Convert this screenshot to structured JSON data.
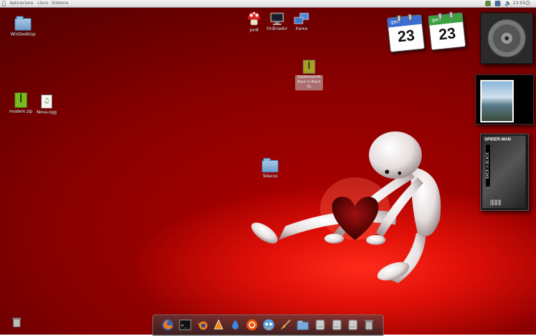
{
  "menubar": {
    "menus": [
      "Aplicacions",
      "Llocs",
      "Sistema"
    ],
    "clock": "23:05"
  },
  "desktop_icons": {
    "windesktop": "WinDesktop",
    "jordi": "jordi",
    "ordinador": "Ordinador",
    "xarxa": "Xarxa",
    "modem": "modem.zip",
    "nova": "Nova.ogg",
    "telecos": "Telecos",
    "selected_file": "Spiderman04 Back in Black 01"
  },
  "calendars": [
    {
      "month": "gen",
      "day": "23",
      "color": "#3a6fd0"
    },
    {
      "month": "gen",
      "day": "23",
      "color": "#3aa040"
    }
  ],
  "dock": {
    "items": [
      "firefox-icon",
      "terminal-icon",
      "blender-icon",
      "vlc-icon",
      "water-drop-icon",
      "ubuntu-icon",
      "pidgin-icon",
      "broom-icon",
      "folder-icon",
      "drive-icon",
      "drive-icon",
      "drive-icon",
      "trash-icon"
    ]
  },
  "widgets": {
    "comic_title": "SPIDER-MAN",
    "comic_subtitle": "BACK in BLACK"
  }
}
